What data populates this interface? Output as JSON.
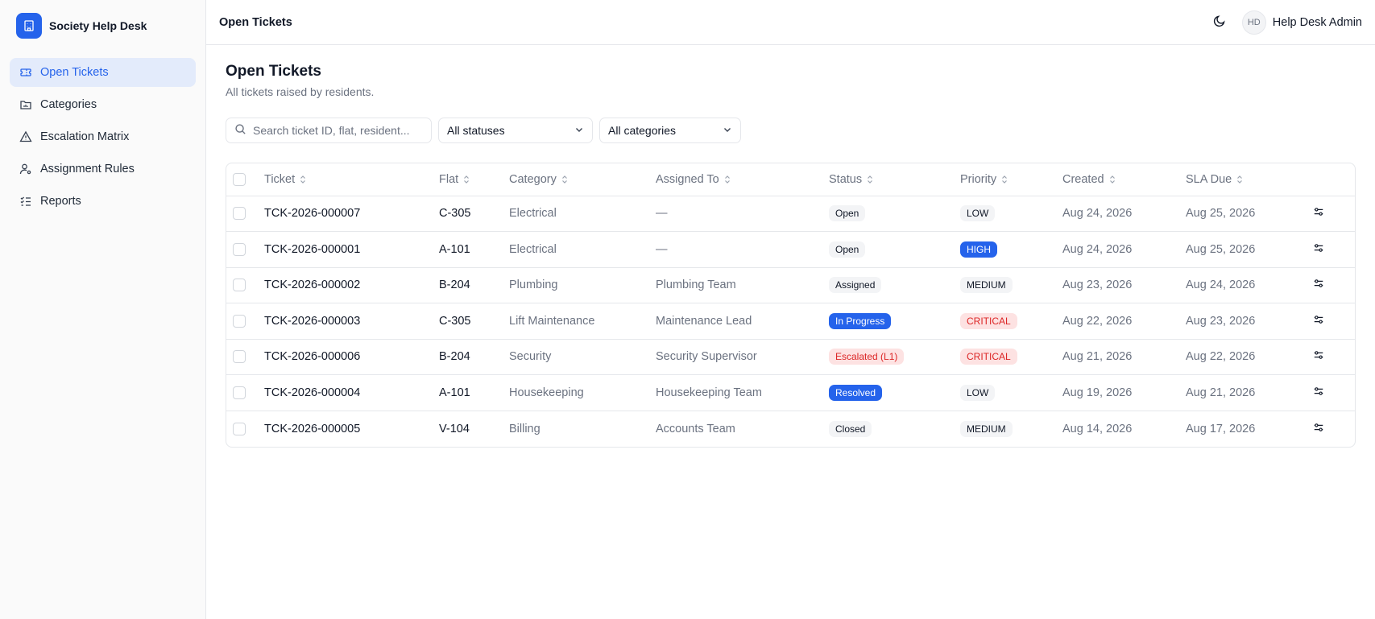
{
  "brand": {
    "name": "Society Help Desk",
    "logo_icon": "building-icon",
    "accent": "#2563eb"
  },
  "sidebar": {
    "items": [
      {
        "label": "Open Tickets",
        "icon": "ticket-icon",
        "active": true
      },
      {
        "label": "Categories",
        "icon": "folder-icon",
        "active": false
      },
      {
        "label": "Escalation Matrix",
        "icon": "warning-triangle-icon",
        "active": false
      },
      {
        "label": "Assignment Rules",
        "icon": "user-gear-icon",
        "active": false
      },
      {
        "label": "Reports",
        "icon": "checklist-icon",
        "active": false
      }
    ]
  },
  "header": {
    "title": "Open Tickets",
    "theme_icon": "moon-icon",
    "user": {
      "initials": "HD",
      "name": "Help Desk Admin"
    }
  },
  "page": {
    "title": "Open Tickets",
    "subtitle": "All tickets raised by residents."
  },
  "filters": {
    "search_placeholder": "Search ticket ID, flat, resident...",
    "status_select": "All statuses",
    "category_select": "All categories"
  },
  "table": {
    "columns": [
      "Ticket",
      "Flat",
      "Category",
      "Assigned To",
      "Status",
      "Priority",
      "Created",
      "SLA Due"
    ],
    "rows": [
      {
        "ticket": "TCK-2026-000007",
        "flat": "C-305",
        "category": "Electrical",
        "assigned": "—",
        "status": "Open",
        "status_kind": "open",
        "priority": "LOW",
        "priority_kind": "low",
        "created": "Aug 24, 2026",
        "sla": "Aug 25, 2026"
      },
      {
        "ticket": "TCK-2026-000001",
        "flat": "A-101",
        "category": "Electrical",
        "assigned": "—",
        "status": "Open",
        "status_kind": "open",
        "priority": "HIGH",
        "priority_kind": "high",
        "created": "Aug 24, 2026",
        "sla": "Aug 25, 2026"
      },
      {
        "ticket": "TCK-2026-000002",
        "flat": "B-204",
        "category": "Plumbing",
        "assigned": "Plumbing Team",
        "status": "Assigned",
        "status_kind": "assigned",
        "priority": "MEDIUM",
        "priority_kind": "medium",
        "created": "Aug 23, 2026",
        "sla": "Aug 24, 2026"
      },
      {
        "ticket": "TCK-2026-000003",
        "flat": "C-305",
        "category": "Lift Maintenance",
        "assigned": "Maintenance Lead",
        "status": "In Progress",
        "status_kind": "progress",
        "priority": "CRITICAL",
        "priority_kind": "critical",
        "created": "Aug 22, 2026",
        "sla": "Aug 23, 2026"
      },
      {
        "ticket": "TCK-2026-000006",
        "flat": "B-204",
        "category": "Security",
        "assigned": "Security Supervisor",
        "status": "Escalated (L1)",
        "status_kind": "escalated",
        "priority": "CRITICAL",
        "priority_kind": "critical",
        "created": "Aug 21, 2026",
        "sla": "Aug 22, 2026"
      },
      {
        "ticket": "TCK-2026-000004",
        "flat": "A-101",
        "category": "Housekeeping",
        "assigned": "Housekeeping Team",
        "status": "Resolved",
        "status_kind": "resolved",
        "priority": "LOW",
        "priority_kind": "low",
        "created": "Aug 19, 2026",
        "sla": "Aug 21, 2026"
      },
      {
        "ticket": "TCK-2026-000005",
        "flat": "V-104",
        "category": "Billing",
        "assigned": "Accounts Team",
        "status": "Closed",
        "status_kind": "closed",
        "priority": "MEDIUM",
        "priority_kind": "medium",
        "created": "Aug 14, 2026",
        "sla": "Aug 17, 2026"
      }
    ],
    "row_action_icon": "sliders-icon"
  }
}
